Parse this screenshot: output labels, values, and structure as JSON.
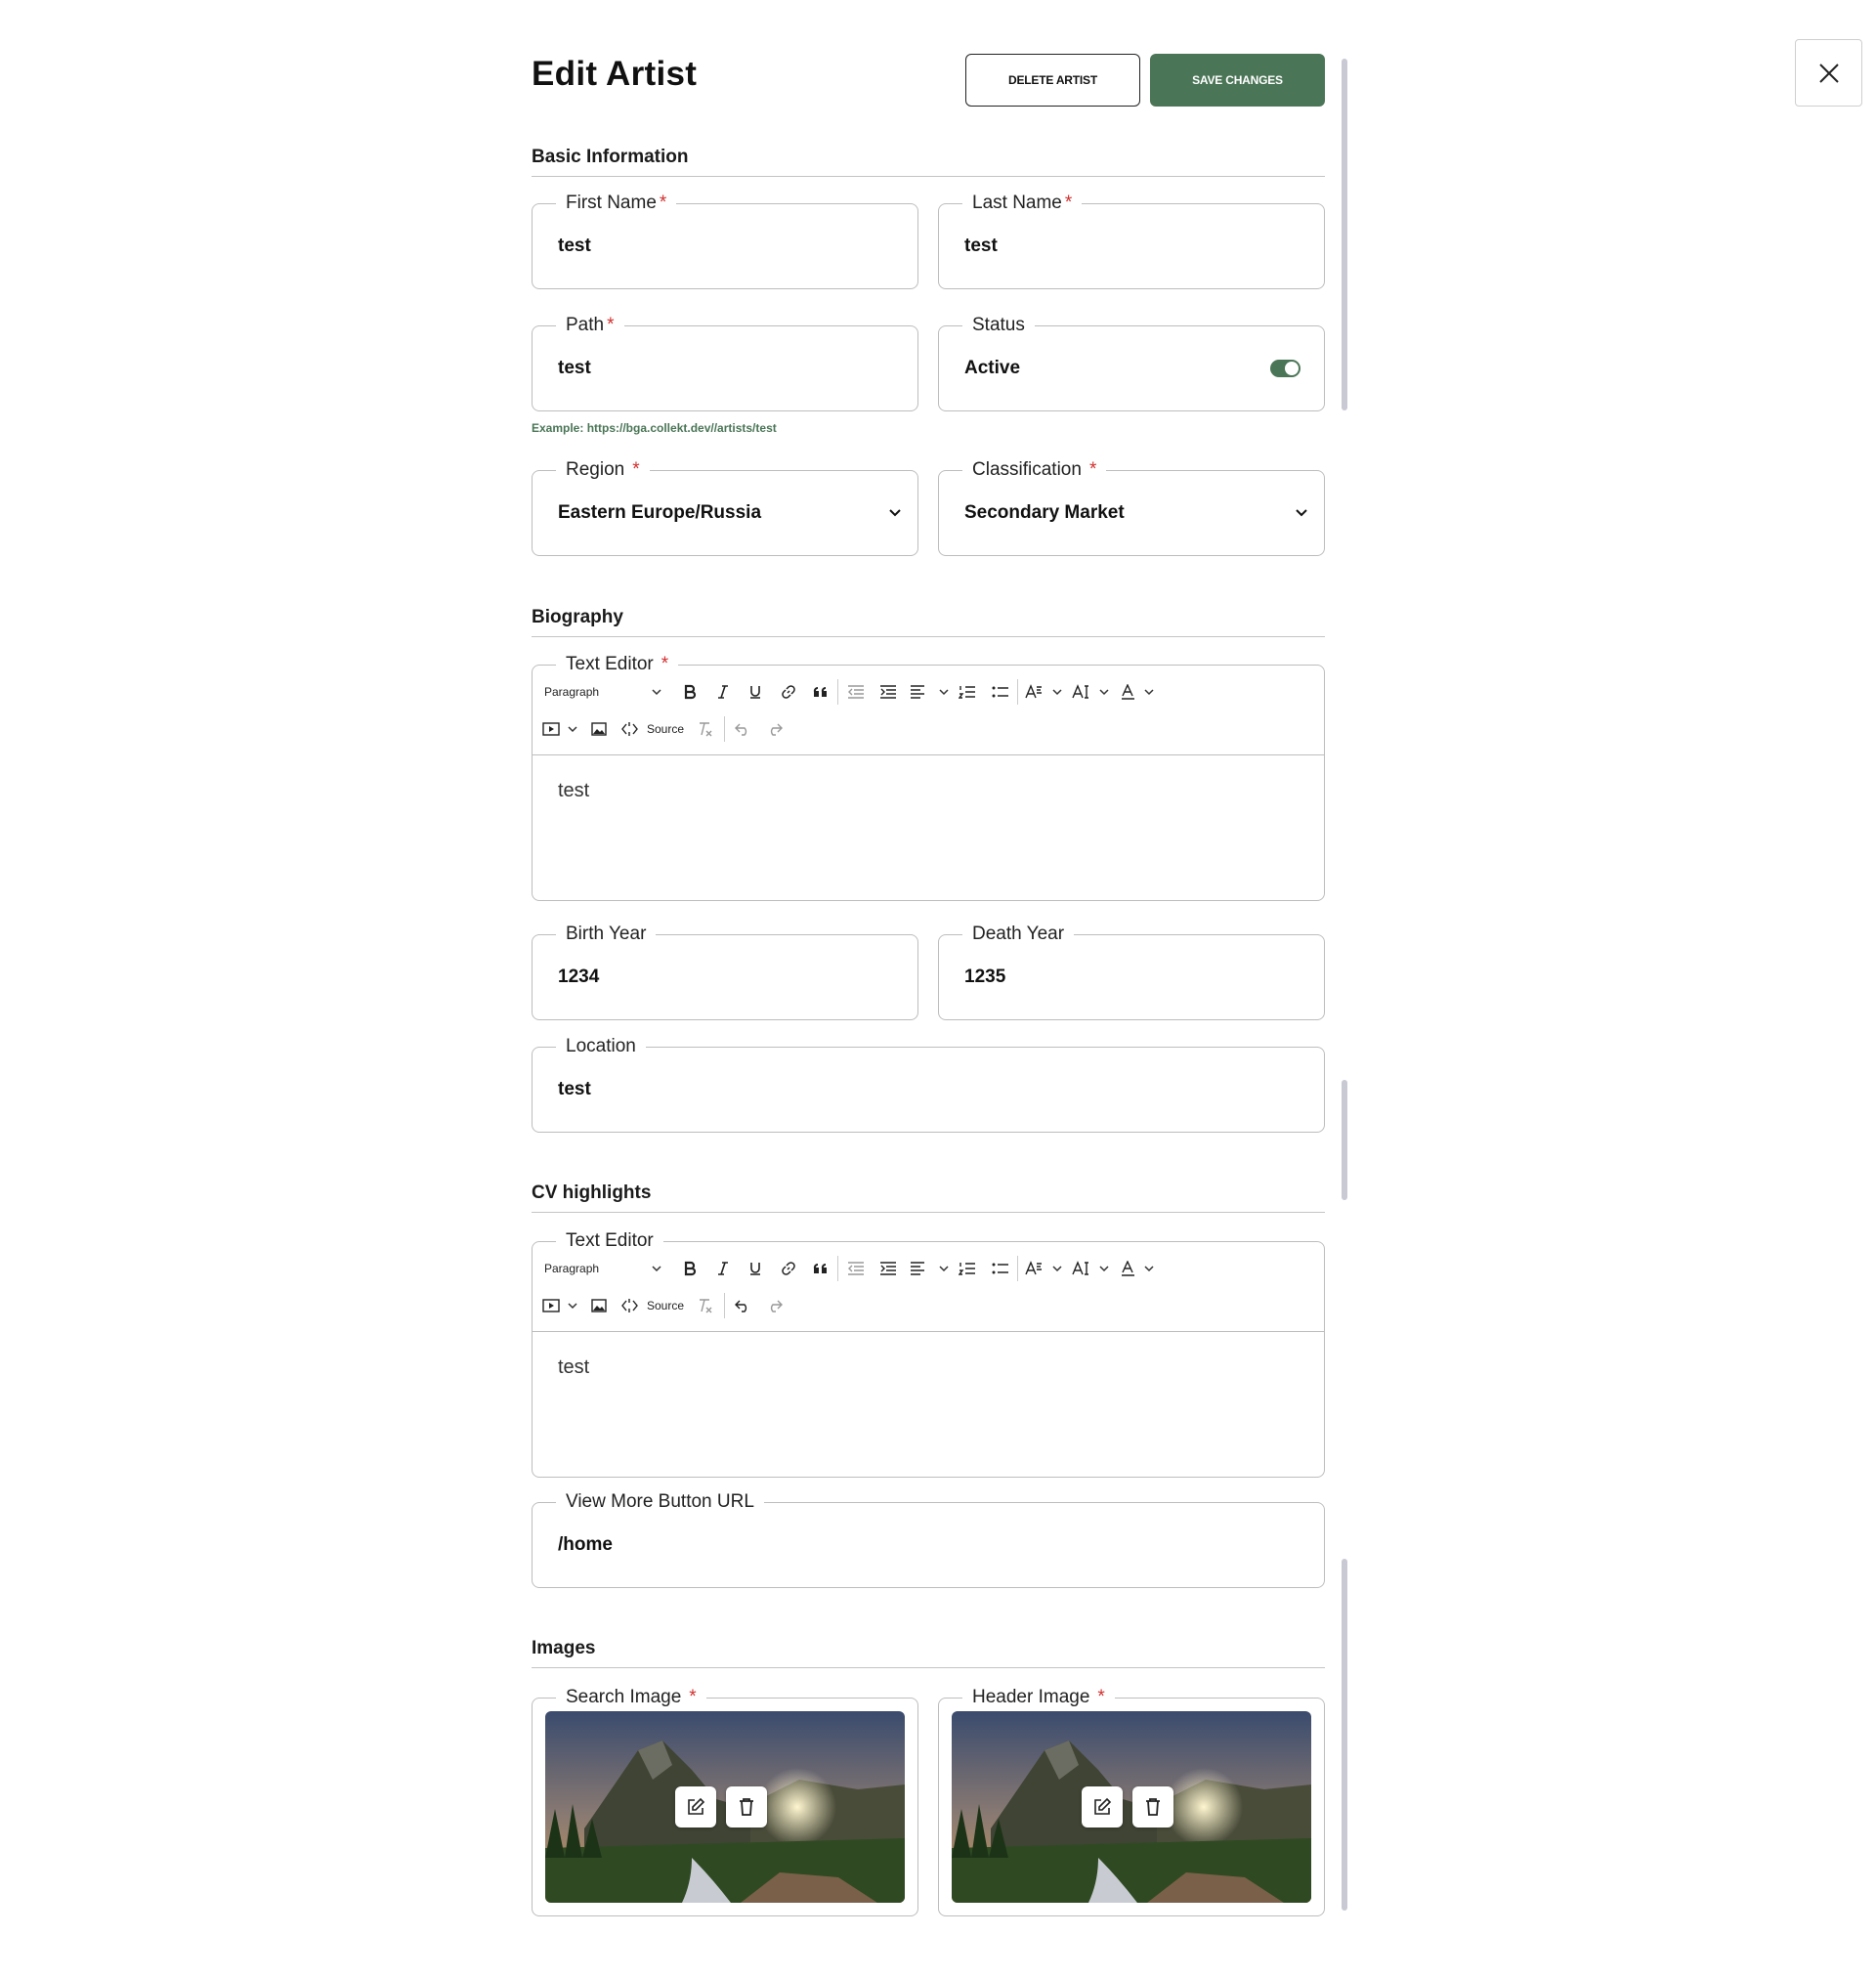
{
  "header": {
    "title": "Edit Artist",
    "delete_label": "DELETE ARTIST",
    "save_label": "SAVE CHANGES"
  },
  "sections": {
    "basic": "Basic Information",
    "biography": "Biography",
    "cv": "CV highlights",
    "images": "Images"
  },
  "fields": {
    "first_name": {
      "label": "First Name",
      "value": "test",
      "required": true
    },
    "last_name": {
      "label": "Last Name",
      "value": "test",
      "required": true
    },
    "path": {
      "label": "Path",
      "value": "test",
      "required": true
    },
    "status": {
      "label": "Status",
      "value": "Active",
      "enabled": true
    },
    "path_hint": "Example: https://bga.collekt.dev//artists/test",
    "region": {
      "label": "Region",
      "value": "Eastern Europe/Russia",
      "required": true
    },
    "classification": {
      "label": "Classification",
      "value": "Secondary Market",
      "required": true
    },
    "birth_year": {
      "label": "Birth Year",
      "value": "1234"
    },
    "death_year": {
      "label": "Death Year",
      "value": "1235"
    },
    "location": {
      "label": "Location",
      "value": "test"
    },
    "view_more_url": {
      "label": "View More Button URL",
      "value": "/home"
    }
  },
  "biography_editor": {
    "label": "Text Editor",
    "required": true,
    "paragraph_label": "Paragraph",
    "source_label": "Source",
    "content": "test"
  },
  "cv_editor": {
    "label": "Text Editor",
    "required": false,
    "paragraph_label": "Paragraph",
    "source_label": "Source",
    "content": "test"
  },
  "images": {
    "search": {
      "label": "Search Image",
      "required": true
    },
    "header": {
      "label": "Header Image",
      "required": true
    }
  },
  "colors": {
    "accent": "#4a7556",
    "required": "#d32f2f",
    "border": "#bdbdbd"
  },
  "icons": [
    "close-icon",
    "chevron-down-icon",
    "bold-icon",
    "italic-icon",
    "underline-icon",
    "link-icon",
    "blockquote-icon",
    "outdent-icon",
    "indent-icon",
    "align-icon",
    "numbered-list-icon",
    "bulleted-list-icon",
    "font-size-icon",
    "font-family-icon",
    "font-color-icon",
    "media-embed-icon",
    "image-icon",
    "source-icon",
    "remove-format-icon",
    "undo-icon",
    "redo-icon",
    "edit-icon",
    "trash-icon"
  ]
}
